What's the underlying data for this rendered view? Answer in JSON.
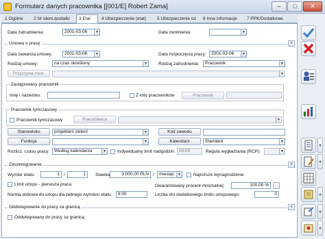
{
  "window": {
    "title": "Formularz danych pracownika [[001/E] Robert Zama]"
  },
  "tabs": [
    {
      "label": "1 Ogólne"
    },
    {
      "label": "2 Nr ident./podatki"
    },
    {
      "label": "3 Etat"
    },
    {
      "label": "4 Ubezpieczenie (etat)"
    },
    {
      "label": "5 Ubezpieczenie cd"
    },
    {
      "label": "6 Inne informacje"
    },
    {
      "label": "7 PPK/Dodatkowe"
    }
  ],
  "etat": {
    "data_zatrudnienia_label": "Data zatrudnienia:",
    "data_zatrudnienia": "2001-03-06",
    "data_zwolnienia_label": "Data zwolnienia:",
    "data_zwolnienia": ""
  },
  "umowa": {
    "title": "Umowa o pracę",
    "data_zawarcia_label": "Data zawarcia umowy:",
    "data_zawarcia": "2001-03-06",
    "data_rozpoczecia_label": "Data rozpoczęcia pracy:",
    "data_rozpoczecia": "2001-03-06",
    "rodzaj_umowy_label": "Rodzaj umowy:",
    "rodzaj_umowy": "na czas określony",
    "rodzaj_zatrudnienia_label": "Rodzaj zatrudnienia:",
    "rodzaj_zatrudnienia": "Pracownik",
    "przyczyna_label": "Przyczyna zwol."
  },
  "zastepowany": {
    "title": "Zastępowany pracownik",
    "imie_label": "Imię i nazwisko:",
    "imie": "",
    "z_listy_label": "Z listy pracowników",
    "pracownik_btn": "Pracownik"
  },
  "tymczasowy": {
    "title": "Pracownik tymczasowy",
    "checkbox_label": "Pracownik tymczasowy",
    "pracodawca_btn": "Pracodawca"
  },
  "stanowisko": {
    "stanowisko_btn": "Stanowisko",
    "stanowisko": "projektant zieleni",
    "kod_zawodu_btn": "Kod zawodu",
    "kod_zawodu": "",
    "funkcja_btn": "Funkcja",
    "funkcja": "",
    "kalendarz_btn": "Kalendarz",
    "kalendarz": "Standard",
    "rozlicz_label": "Rozlicz. czasu pracy:",
    "rozlicz": "Według kalendarza",
    "limit_label": "Indywidualny limit nadgodzin:",
    "limit": "00:00",
    "regula_label": "Reguła wygładzania (RCP):",
    "regula": ""
  },
  "zaszeregowanie": {
    "title": "Zaszeregowanie",
    "wymiar_label": "Wymiar etatu:",
    "wymiar_licznik": "1",
    "wymiar_sep": "/",
    "wymiar_mianownik": "1",
    "stawka_label": "Stawka:",
    "stawka": "3 000,00 PLN",
    "stawka_okres": "miesiąc",
    "najnizsze_label": "Najniższe wynagrodzenie",
    "limit_urlopu_label": "Limit urlopu - pierwsza praca",
    "gwarantowany_label": "Gwarantowany procent minimalnej:",
    "gwarantowany": "100,00 %",
    "norma_label": "Norma dobowa do urlopu dla pełnego wymiaru etatu:",
    "norma": "8:00",
    "liczba_dni_label": "Liczba dni dodatkowego limitu urlopowego:",
    "liczba_dni": "0"
  },
  "oddelegowanie": {
    "title": "Oddelegowanie do pracy za granicą",
    "checkbox_label": "Oddelegowany do pracy za granicą"
  },
  "window_controls": {
    "minimize": "–",
    "maximize": "□",
    "close": "✕"
  },
  "icons": {
    "collapse": "«",
    "dropdown": "▼"
  },
  "colors": {
    "save_check": "#3a7fd0",
    "cancel_x": "#d42020"
  }
}
